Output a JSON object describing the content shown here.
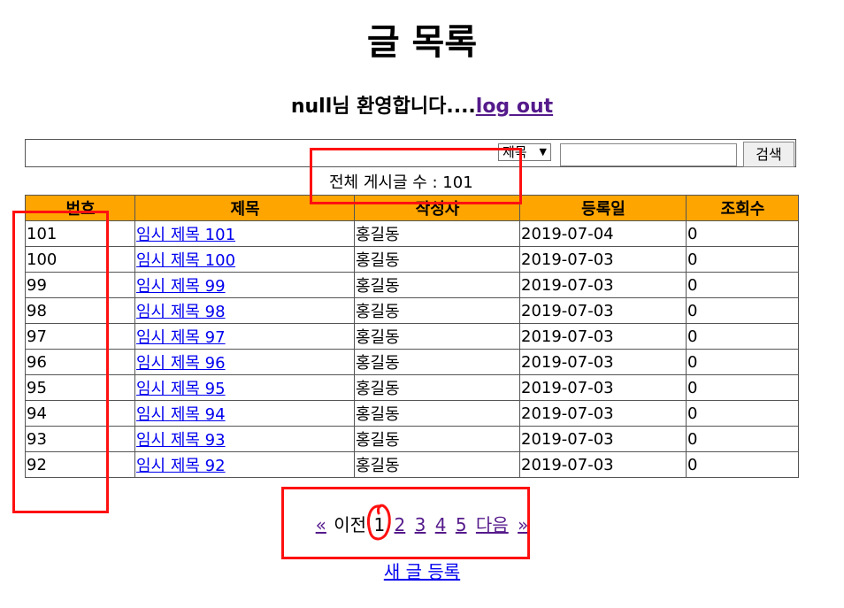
{
  "page": {
    "title": "글 목록",
    "welcome_text": "null님 환영합니다....",
    "logout_label": "log out"
  },
  "search": {
    "select_value": "제목",
    "button_label": "검색",
    "placeholder": ""
  },
  "total": {
    "text": "전체 게시글 수 : 101"
  },
  "table": {
    "headers": [
      "번호",
      "제목",
      "작성자",
      "등록일",
      "조회수"
    ],
    "rows": [
      {
        "num": "101",
        "title": "임시 제목 101",
        "author": "홍길동",
        "date": "2019-07-04",
        "views": "0"
      },
      {
        "num": "100",
        "title": "임시 제목 100",
        "author": "홍길동",
        "date": "2019-07-03",
        "views": "0"
      },
      {
        "num": "99",
        "title": "임시 제목 99",
        "author": "홍길동",
        "date": "2019-07-03",
        "views": "0"
      },
      {
        "num": "98",
        "title": "임시 제목 98",
        "author": "홍길동",
        "date": "2019-07-03",
        "views": "0"
      },
      {
        "num": "97",
        "title": "임시 제목 97",
        "author": "홍길동",
        "date": "2019-07-03",
        "views": "0"
      },
      {
        "num": "96",
        "title": "임시 제목 96",
        "author": "홍길동",
        "date": "2019-07-03",
        "views": "0"
      },
      {
        "num": "95",
        "title": "임시 제목 95",
        "author": "홍길동",
        "date": "2019-07-03",
        "views": "0"
      },
      {
        "num": "94",
        "title": "임시 제목 94",
        "author": "홍길동",
        "date": "2019-07-03",
        "views": "0"
      },
      {
        "num": "93",
        "title": "임시 제목 93",
        "author": "홍길동",
        "date": "2019-07-03",
        "views": "0"
      },
      {
        "num": "92",
        "title": "임시 제목 92",
        "author": "홍길동",
        "date": "2019-07-03",
        "views": "0"
      }
    ]
  },
  "pager": {
    "prev_label": "«",
    "prev_text": "이전",
    "current": "1",
    "pages": [
      "2",
      "3",
      "4",
      "5"
    ],
    "next_text": "다음",
    "next_label": "»"
  },
  "new_post_label": "새 글 등록",
  "colors": {
    "header_bg": "#ffa500",
    "annotation_red": "#ff1010",
    "link_blue": "#0000ee",
    "link_visited": "#551a8b"
  }
}
